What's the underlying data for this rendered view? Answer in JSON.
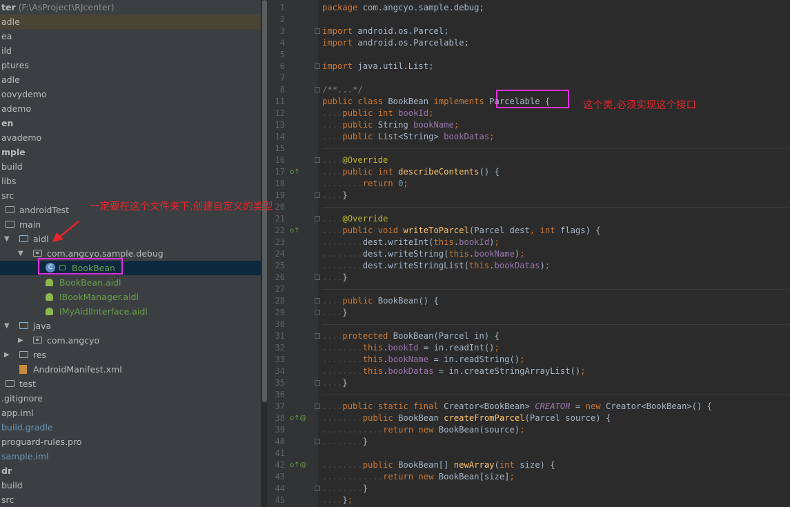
{
  "tree": [
    {
      "parts": [
        {
          "t": "ter",
          "b": true
        },
        {
          "t": " (F:\\AsProject\\RJcenter)",
          "m": true
        }
      ],
      "x": 0,
      "icon": "none"
    },
    {
      "parts": [
        {
          "t": "adle"
        }
      ],
      "x": 0,
      "icon": "none",
      "hl": true
    },
    {
      "parts": [
        {
          "t": "ea"
        }
      ],
      "x": 0,
      "icon": "none"
    },
    {
      "parts": [
        {
          "t": "ild"
        }
      ],
      "x": 0,
      "icon": "none"
    },
    {
      "parts": [
        {
          "t": "ptures"
        }
      ],
      "x": 0,
      "icon": "none"
    },
    {
      "parts": [
        {
          "t": "adle"
        }
      ],
      "x": 0,
      "icon": "none"
    },
    {
      "parts": [
        {
          "t": "oovydemo"
        }
      ],
      "x": 0,
      "icon": "none"
    },
    {
      "parts": [
        {
          "t": "ademo"
        }
      ],
      "x": 0,
      "icon": "none"
    },
    {
      "parts": [
        {
          "t": "en",
          "b": true
        }
      ],
      "x": 0,
      "icon": "none"
    },
    {
      "parts": [
        {
          "t": "avademo"
        }
      ],
      "x": 0,
      "icon": "none"
    },
    {
      "parts": [
        {
          "t": "mple",
          "b": true
        }
      ],
      "x": 0,
      "icon": "none"
    },
    {
      "parts": [
        {
          "t": "build"
        }
      ],
      "x": 0,
      "icon": "none"
    },
    {
      "parts": [
        {
          "t": "libs"
        }
      ],
      "x": 0,
      "icon": "none"
    },
    {
      "parts": [
        {
          "t": "src"
        }
      ],
      "x": 0,
      "icon": "none"
    },
    {
      "parts": [
        {
          "t": "androidTest"
        }
      ],
      "x": 8,
      "icon": "folder"
    },
    {
      "parts": [
        {
          "t": "main"
        }
      ],
      "x": 8,
      "icon": "folder"
    },
    {
      "parts": [
        {
          "t": "aidl"
        }
      ],
      "x": 8,
      "icon": "folder",
      "arrow": "▼",
      "blue_folder": true
    },
    {
      "parts": [
        {
          "t": "com.angcyo.sample.debug"
        }
      ],
      "x": 28,
      "icon": "pkg",
      "arrow": "▼"
    },
    {
      "parts": [
        {
          "t": "BookBean",
          "g": true
        }
      ],
      "x": 66,
      "icon": "class",
      "sel": true
    },
    {
      "parts": [
        {
          "t": "BookBean.aidl",
          "g": true
        }
      ],
      "x": 66,
      "icon": "droid"
    },
    {
      "parts": [
        {
          "t": "IBookManager.aidl",
          "g": true
        }
      ],
      "x": 66,
      "icon": "droid"
    },
    {
      "parts": [
        {
          "t": "IMyAidlInterface.aidl",
          "g": true
        }
      ],
      "x": 66,
      "icon": "droid"
    },
    {
      "parts": [
        {
          "t": "java"
        }
      ],
      "x": 8,
      "icon": "folder",
      "arrow": "▼",
      "blue_folder": true
    },
    {
      "parts": [
        {
          "t": "com.angcyo"
        }
      ],
      "x": 28,
      "icon": "pkg",
      "arrow": "▶"
    },
    {
      "parts": [
        {
          "t": "res"
        }
      ],
      "x": 8,
      "icon": "folder",
      "arrow": "▶"
    },
    {
      "parts": [
        {
          "t": "AndroidManifest.xml"
        }
      ],
      "x": 28,
      "icon": "file"
    },
    {
      "parts": [
        {
          "t": "test"
        }
      ],
      "x": 8,
      "icon": "folder"
    },
    {
      "parts": [
        {
          "t": ".gitignore"
        }
      ],
      "x": 0,
      "icon": "none"
    },
    {
      "parts": [
        {
          "t": "app.iml"
        }
      ],
      "x": 0,
      "icon": "none"
    },
    {
      "parts": [
        {
          "t": "build.gradle",
          "bl": true
        }
      ],
      "x": 0,
      "icon": "none"
    },
    {
      "parts": [
        {
          "t": "proguard-rules.pro"
        }
      ],
      "x": 0,
      "icon": "none"
    },
    {
      "parts": [
        {
          "t": "sample.iml",
          "bl": true
        }
      ],
      "x": 0,
      "icon": "none"
    },
    {
      "parts": [
        {
          "t": "dr",
          "b": true
        }
      ],
      "x": 0,
      "icon": "none"
    },
    {
      "parts": [
        {
          "t": "build"
        }
      ],
      "x": 0,
      "icon": "none"
    },
    {
      "parts": [
        {
          "t": "src"
        }
      ],
      "x": 0,
      "icon": "none"
    }
  ],
  "code": [
    {
      "n": "1",
      "s": [
        [
          "k",
          "package "
        ],
        [
          "",
          "com.angcyo.sample.debug;"
        ]
      ]
    },
    {
      "n": "2",
      "s": []
    },
    {
      "n": "3",
      "s": [
        [
          "k",
          "import "
        ],
        [
          "",
          "android.os.Parcel;"
        ]
      ],
      "fold": true
    },
    {
      "n": "4",
      "s": [
        [
          "k",
          "import "
        ],
        [
          "",
          "android.os.Parcelable;"
        ]
      ]
    },
    {
      "n": "5",
      "s": []
    },
    {
      "n": "6",
      "s": [
        [
          "k",
          "import "
        ],
        [
          "",
          "java.util.List;"
        ]
      ],
      "fold": true
    },
    {
      "n": "7",
      "s": []
    },
    {
      "n": "8",
      "s": [
        [
          "cm",
          "/**...*/"
        ]
      ],
      "fold": true
    },
    {
      "n": "11",
      "s": [
        [
          "k",
          "public class "
        ],
        [
          "",
          "BookBean "
        ],
        [
          "k",
          "implements "
        ],
        [
          "",
          "Parcelable {"
        ]
      ]
    },
    {
      "n": "12",
      "s": [
        [
          "dot",
          "...."
        ],
        [
          "k",
          "public int "
        ],
        [
          "f",
          "bookId"
        ],
        [
          "k",
          ";"
        ]
      ]
    },
    {
      "n": "13",
      "s": [
        [
          "dot",
          "...."
        ],
        [
          "k",
          "public "
        ],
        [
          "",
          "String "
        ],
        [
          "f",
          "bookName"
        ],
        [
          "k",
          ";"
        ]
      ]
    },
    {
      "n": "14",
      "s": [
        [
          "dot",
          "...."
        ],
        [
          "k",
          "public "
        ],
        [
          "",
          "List<String> "
        ],
        [
          "f",
          "bookDatas"
        ],
        [
          "k",
          ";"
        ]
      ]
    },
    {
      "n": "15",
      "s": [],
      "sep": true
    },
    {
      "n": "16",
      "s": [
        [
          "dot",
          "...."
        ],
        [
          "an",
          "@Override"
        ]
      ],
      "fold": true
    },
    {
      "n": "17",
      "s": [
        [
          "dot",
          "...."
        ],
        [
          "k",
          "public int "
        ],
        [
          "fn",
          "describeContents"
        ],
        [
          "",
          "() {"
        ]
      ],
      "mark": "o↑"
    },
    {
      "n": "18",
      "s": [
        [
          "dot",
          "........"
        ],
        [
          "k",
          "return "
        ],
        [
          "num",
          "0"
        ],
        [
          "k",
          ";"
        ]
      ]
    },
    {
      "n": "19",
      "s": [
        [
          "dot",
          "...."
        ],
        [
          "",
          "}"
        ]
      ],
      "fold": true
    },
    {
      "n": "20",
      "s": [],
      "sep": true
    },
    {
      "n": "21",
      "s": [
        [
          "dot",
          "...."
        ],
        [
          "an",
          "@Override"
        ]
      ],
      "fold": true
    },
    {
      "n": "22",
      "s": [
        [
          "dot",
          "...."
        ],
        [
          "k",
          "public void "
        ],
        [
          "fn",
          "writeToParcel"
        ],
        [
          "",
          "(Parcel dest"
        ],
        [
          "k",
          ", int "
        ],
        [
          "",
          "flags) {"
        ]
      ],
      "mark": "o↑"
    },
    {
      "n": "23",
      "s": [
        [
          "dot",
          "........"
        ],
        [
          "",
          "dest.writeInt("
        ],
        [
          "k",
          "this"
        ],
        [
          "",
          "."
        ],
        [
          "f",
          "bookId"
        ],
        [
          "",
          ")"
        ],
        [
          "k",
          ";"
        ]
      ]
    },
    {
      "n": "24",
      "s": [
        [
          "dot",
          "........"
        ],
        [
          "",
          "dest.writeString("
        ],
        [
          "k",
          "this"
        ],
        [
          "",
          "."
        ],
        [
          "f",
          "bookName"
        ],
        [
          "",
          ")"
        ],
        [
          "k",
          ";"
        ]
      ]
    },
    {
      "n": "25",
      "s": [
        [
          "dot",
          "........"
        ],
        [
          "",
          "dest.writeStringList("
        ],
        [
          "k",
          "this"
        ],
        [
          "",
          "."
        ],
        [
          "f",
          "bookDatas"
        ],
        [
          "",
          ")"
        ],
        [
          "k",
          ";"
        ]
      ]
    },
    {
      "n": "26",
      "s": [
        [
          "dot",
          "...."
        ],
        [
          "",
          "}"
        ]
      ],
      "fold": true
    },
    {
      "n": "27",
      "s": [],
      "sep": true
    },
    {
      "n": "28",
      "s": [
        [
          "dot",
          "...."
        ],
        [
          "k",
          "public "
        ],
        [
          "",
          "BookBean() {"
        ]
      ],
      "fold": true
    },
    {
      "n": "29",
      "s": [
        [
          "dot",
          "...."
        ],
        [
          "",
          "}"
        ]
      ],
      "fold": true
    },
    {
      "n": "30",
      "s": [],
      "sep": true
    },
    {
      "n": "31",
      "s": [
        [
          "dot",
          "...."
        ],
        [
          "k",
          "protected "
        ],
        [
          "",
          "BookBean(Parcel in) {"
        ]
      ],
      "fold": true
    },
    {
      "n": "32",
      "s": [
        [
          "dot",
          "........"
        ],
        [
          "k",
          "this"
        ],
        [
          "",
          "."
        ],
        [
          "f",
          "bookId "
        ],
        [
          "",
          "= in.readInt()"
        ],
        [
          "k",
          ";"
        ]
      ]
    },
    {
      "n": "33",
      "s": [
        [
          "dot",
          "........"
        ],
        [
          "k",
          "this"
        ],
        [
          "",
          "."
        ],
        [
          "f",
          "bookName "
        ],
        [
          "",
          "= in.readString()"
        ],
        [
          "k",
          ";"
        ]
      ]
    },
    {
      "n": "34",
      "s": [
        [
          "dot",
          "........"
        ],
        [
          "k",
          "this"
        ],
        [
          "",
          "."
        ],
        [
          "f",
          "bookDatas "
        ],
        [
          "",
          "= in.createStringArrayList()"
        ],
        [
          "k",
          ";"
        ]
      ]
    },
    {
      "n": "35",
      "s": [
        [
          "dot",
          "...."
        ],
        [
          "",
          "}"
        ]
      ],
      "fold": true
    },
    {
      "n": "36",
      "s": [],
      "sep": true
    },
    {
      "n": "37",
      "s": [
        [
          "dot",
          "...."
        ],
        [
          "k",
          "public static final "
        ],
        [
          "",
          "Creator<BookBean> "
        ],
        [
          "fi",
          "CREATOR "
        ],
        [
          "",
          "= "
        ],
        [
          "k",
          "new "
        ],
        [
          "",
          "Creator<BookBean>() {"
        ]
      ],
      "fold": true
    },
    {
      "n": "38",
      "s": [
        [
          "dot",
          "........"
        ],
        [
          "k",
          "public "
        ],
        [
          "",
          "BookBean "
        ],
        [
          "fn",
          "createFromParcel"
        ],
        [
          "",
          "(Parcel source) {"
        ]
      ],
      "mark": "o↑@"
    },
    {
      "n": "39",
      "s": [
        [
          "dot",
          "............"
        ],
        [
          "k",
          "return new "
        ],
        [
          "",
          "BookBean(source)"
        ],
        [
          "k",
          ";"
        ]
      ]
    },
    {
      "n": "40",
      "s": [
        [
          "dot",
          "........"
        ],
        [
          "",
          "}"
        ]
      ],
      "fold": true
    },
    {
      "n": "41",
      "s": []
    },
    {
      "n": "42",
      "s": [
        [
          "dot",
          "........"
        ],
        [
          "k",
          "public "
        ],
        [
          "",
          "BookBean[] "
        ],
        [
          "fn",
          "newArray"
        ],
        [
          "",
          "("
        ],
        [
          "k",
          "int "
        ],
        [
          "",
          "size) {"
        ]
      ],
      "mark": "o↑@"
    },
    {
      "n": "43",
      "s": [
        [
          "dot",
          "............"
        ],
        [
          "k",
          "return new "
        ],
        [
          "",
          "BookBean[size]"
        ],
        [
          "k",
          ";"
        ]
      ]
    },
    {
      "n": "44",
      "s": [
        [
          "dot",
          "........"
        ],
        [
          "",
          "}"
        ]
      ],
      "fold": true
    },
    {
      "n": "45",
      "s": [
        [
          "dot",
          "...."
        ],
        [
          "",
          "}"
        ],
        [
          "k",
          ";"
        ]
      ]
    }
  ],
  "annotations": {
    "tree_note": "一定要在这个文件夹下,创建自定义的类型",
    "code_note": "这个类,必须实现这个接口"
  },
  "colors": {
    "highlight_box": "#e22fe0",
    "annotation_text": "#e8252b"
  }
}
